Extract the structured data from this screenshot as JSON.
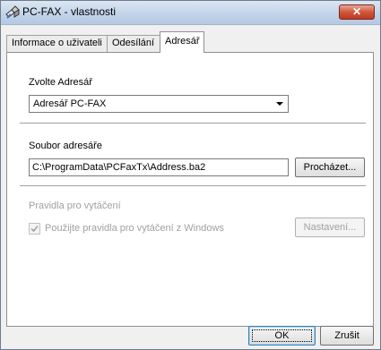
{
  "window": {
    "title": "PC-FAX - vlastnosti",
    "close_label": "✕",
    "close_color": "#c7452c"
  },
  "tabs": [
    {
      "label": "Informace o uživateli",
      "active": false
    },
    {
      "label": "Odesílání",
      "active": false
    },
    {
      "label": "Adresář",
      "active": true
    }
  ],
  "addressbook": {
    "choose_label": "Zvolte Adresář",
    "selected": "Adresář PC-FAX",
    "file_label": "Soubor adresáře",
    "file_path": "C:\\ProgramData\\PCFaxTx\\Address.ba2",
    "browse_label": "Procházet..."
  },
  "dialing": {
    "group_label": "Pravidla pro vytáčení",
    "checkbox_label": "Použijte pravidla pro vytáčení z Windows",
    "checkbox_checked": true,
    "settings_label": "Nastavení...",
    "enabled": false
  },
  "footer": {
    "ok_label": "OK",
    "cancel_label": "Zrušit"
  }
}
